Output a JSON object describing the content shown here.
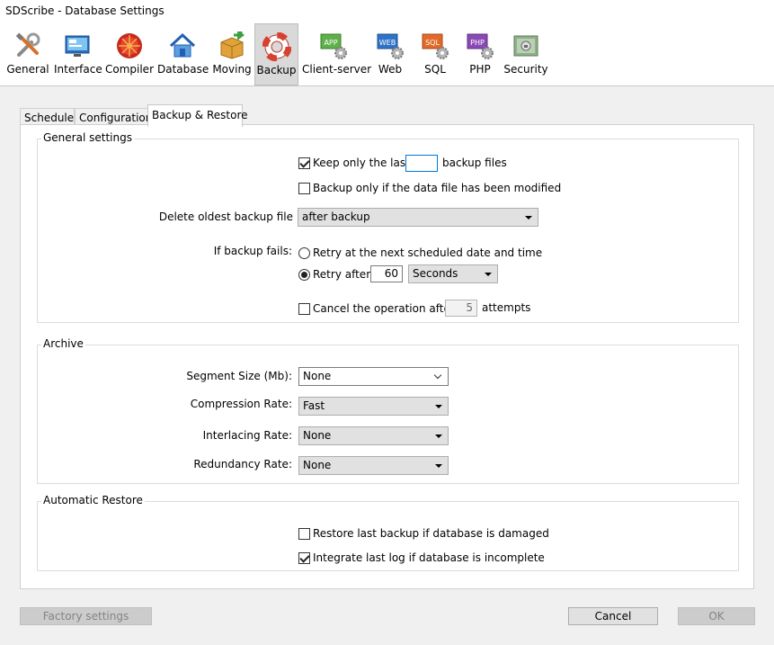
{
  "window": {
    "title": "SDScribe - Database Settings"
  },
  "toolbar": {
    "items": [
      {
        "label": "General",
        "icon": "tools-icon"
      },
      {
        "label": "Interface",
        "icon": "interface-icon"
      },
      {
        "label": "Compiler",
        "icon": "compiler-icon"
      },
      {
        "label": "Database",
        "icon": "database-house-icon"
      },
      {
        "label": "Moving",
        "icon": "moving-box-icon"
      },
      {
        "label": "Backup",
        "icon": "lifebuoy-icon",
        "selected": true
      },
      {
        "label": "Client-server",
        "icon": "app-gear-icon",
        "badge": "APP"
      },
      {
        "label": "Web",
        "icon": "web-gear-icon",
        "badge": "WEB"
      },
      {
        "label": "SQL",
        "icon": "sql-gear-icon",
        "badge": "SQL"
      },
      {
        "label": "PHP",
        "icon": "php-gear-icon",
        "badge": "PHP"
      },
      {
        "label": "Security",
        "icon": "security-icon"
      }
    ]
  },
  "tabs": [
    {
      "label": "Scheduler"
    },
    {
      "label": "Configuration"
    },
    {
      "label": "Backup & Restore",
      "active": true
    }
  ],
  "general": {
    "title": "General settings",
    "keep_last_label": "Keep only the last",
    "keep_last_value": "",
    "keep_last_suffix": "backup files",
    "only_modified_label": "Backup only if the data file has been modified",
    "delete_label": "Delete oldest backup file",
    "delete_value": "after backup",
    "fails_label": "If backup fails:",
    "retry_next_label": "Retry at the next scheduled date and time",
    "retry_after_label": "Retry after",
    "retry_after_value": "60",
    "retry_unit": "Seconds",
    "cancel_label": "Cancel the operation after",
    "cancel_value": "5",
    "cancel_suffix": "attempts"
  },
  "archive": {
    "title": "Archive",
    "segment_label": "Segment Size (Mb):",
    "segment_value": "None",
    "compression_label": "Compression Rate:",
    "compression_value": "Fast",
    "interlacing_label": "Interlacing Rate:",
    "interlacing_value": "None",
    "redundancy_label": "Redundancy Rate:",
    "redundancy_value": "None"
  },
  "restore": {
    "title": "Automatic Restore",
    "restore_damaged_label": "Restore last backup if database is damaged",
    "integrate_log_label": "Integrate last log if database is incomplete"
  },
  "footer": {
    "factory_label": "Factory settings",
    "cancel_label": "Cancel",
    "ok_label": "OK"
  }
}
